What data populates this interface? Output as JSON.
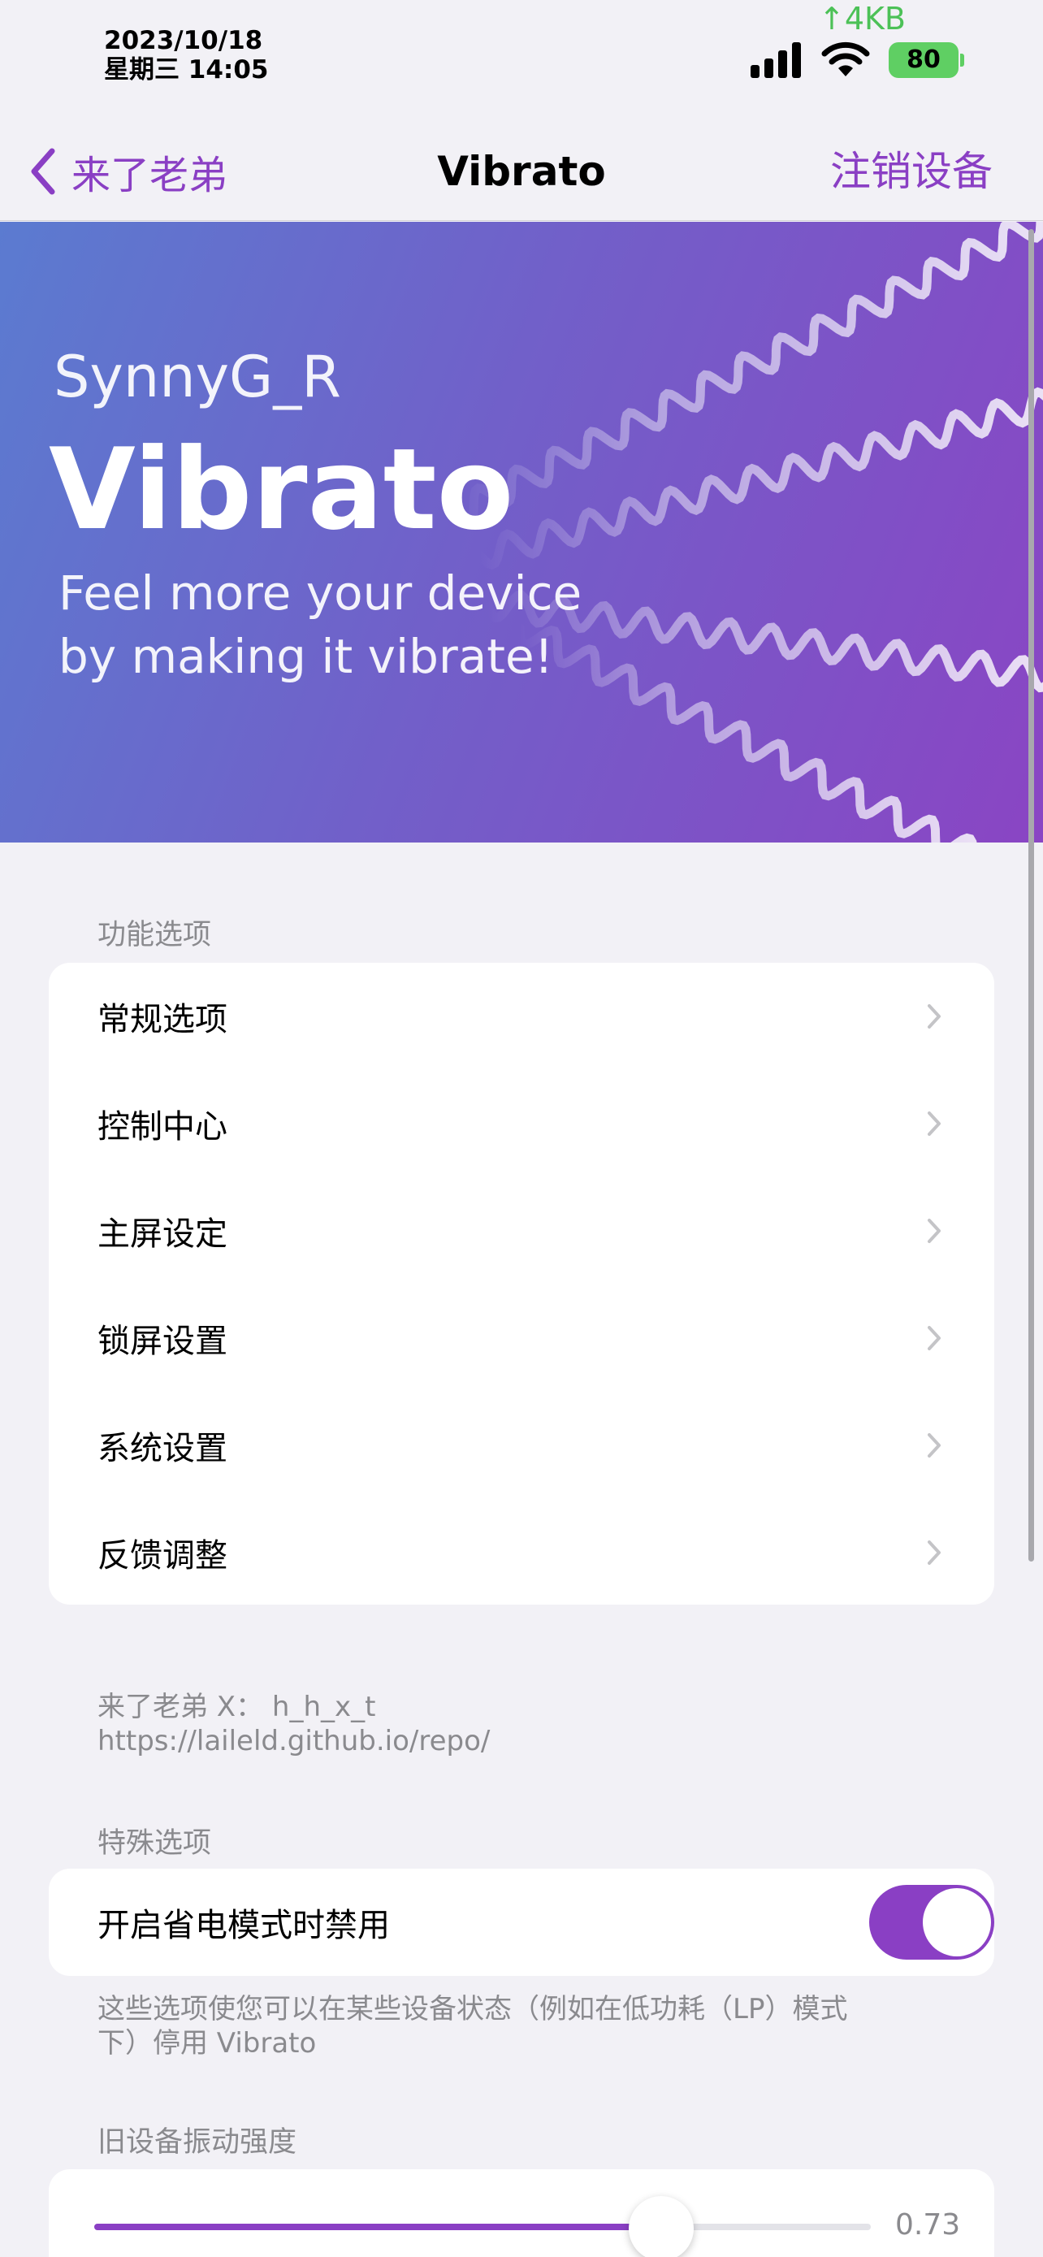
{
  "status_bar": {
    "date": "2023/10/18",
    "weekday_time": "星期三 14:05",
    "net_speed": "↑4KB",
    "battery": "80"
  },
  "nav": {
    "back_label": "来了老弟",
    "title": "Vibrato",
    "right_label": "注销设备"
  },
  "banner": {
    "author": "SynnyG_R",
    "title": "Vibrato",
    "subtitle_line1": "Feel more your device",
    "subtitle_line2": "by making it vibrate!"
  },
  "features": {
    "header": "功能选项",
    "items": [
      {
        "label": "常规选项"
      },
      {
        "label": "控制中心"
      },
      {
        "label": "主屏设定"
      },
      {
        "label": "锁屏设置"
      },
      {
        "label": "系统设置"
      },
      {
        "label": "反馈调整"
      }
    ],
    "footer_line1": "来了老弟 X： h_h_x_t",
    "footer_line2": "https://laileld.github.io/repo/"
  },
  "special": {
    "header": "特殊选项",
    "toggle_label": "开启省电模式时禁用",
    "toggle_on": true,
    "footer_line1": "这些选项使您可以在某些设备状态（例如在低功耗（LP）模式",
    "footer_line2": "下）停用 Vibrato"
  },
  "intensity": {
    "header": "旧设备振动强度",
    "value": 0.73,
    "value_label": "0.73"
  },
  "colors": {
    "accent": "#8a3fc4",
    "background": "#f2f1f6",
    "network_speed": "#4cc157",
    "battery": "#5fcf63"
  }
}
